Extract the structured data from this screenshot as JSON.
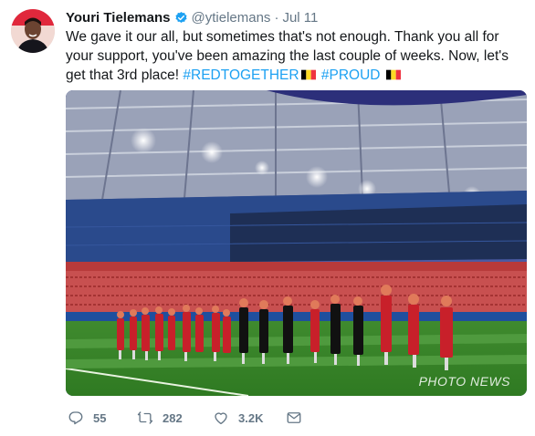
{
  "tweet": {
    "author_name": "Youri Tielemans",
    "handle": "@ytielemans",
    "separator": "·",
    "time": "Jul 11",
    "text_main": "We gave it our all, but sometimes that's not enough. Thank you all for your support, you've been amazing the last couple of weeks. Now, let's get that 3rd place!",
    "hashtag_1": "#REDTOGETHER",
    "hashtag_2": "#PROUD",
    "photo_watermark": "PHOTO NEWS"
  },
  "actions": {
    "reply_count": "55",
    "retweet_count": "282",
    "like_count": "3.2K"
  },
  "icons": {
    "verified": "verified-badge-icon",
    "reply": "reply-icon",
    "retweet": "retweet-icon",
    "like": "heart-icon",
    "dm": "envelope-icon",
    "flag": "belgium-flag-emoji"
  },
  "colors": {
    "hashtag": "#1da1f2",
    "secondary_text": "#657786",
    "verified": "#1da1f2",
    "flag_black": "#000000",
    "flag_yellow": "#fdda24",
    "flag_red": "#ef3340"
  }
}
